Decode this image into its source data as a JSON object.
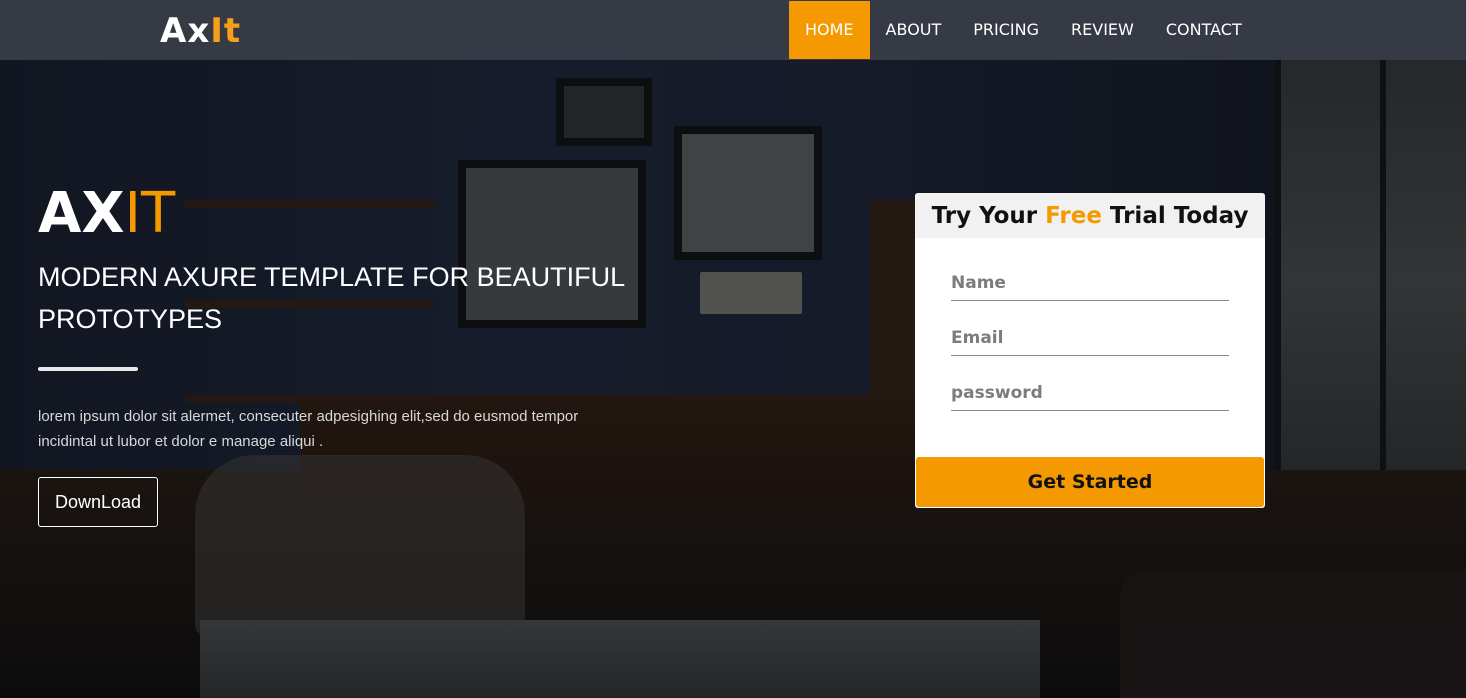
{
  "brand": {
    "logo_white": "Ax",
    "logo_orange": "It"
  },
  "nav": {
    "items": [
      {
        "label": "HOME",
        "active": true
      },
      {
        "label": "ABOUT",
        "active": false
      },
      {
        "label": "PRICING",
        "active": false
      },
      {
        "label": "REVIEW",
        "active": false
      },
      {
        "label": "CONTACT",
        "active": false
      }
    ]
  },
  "hero": {
    "title_white": "AX",
    "title_orange": "IT",
    "subtitle": "MODERN AXURE TEMPLATE FOR BEAUTIFUL PROTOTYPES",
    "description": "lorem ipsum dolor sit alermet, consecuter adpesighing elit,sed do eusmod tempor incidintal ut lubor et dolor e manage aliqui .",
    "download_label": "DownLoad"
  },
  "signup": {
    "heading_pre": "Try Your ",
    "heading_highlight": "Free",
    "heading_post": " Trial Today",
    "name_placeholder": "Name",
    "email_placeholder": "Email",
    "password_placeholder": "password",
    "submit_label": "Get Started"
  },
  "colors": {
    "accent": "#f49a00",
    "navbar_bg": "#353a44",
    "text_light": "#ffffff"
  }
}
